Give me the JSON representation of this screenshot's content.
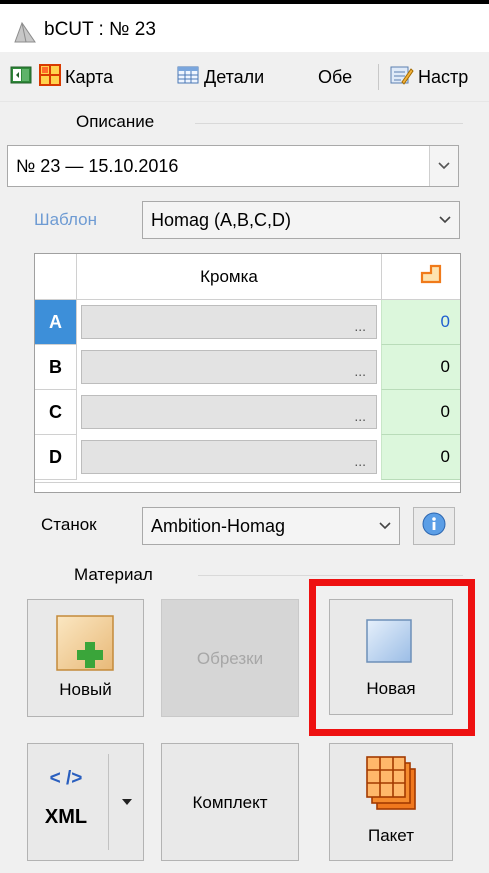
{
  "window": {
    "title": "bCUT : № 23"
  },
  "toolbar": {
    "items": [
      {
        "label": ""
      },
      {
        "label": "Карта"
      },
      {
        "label": "Детали"
      },
      {
        "label": "Обе"
      },
      {
        "label": "Настр"
      }
    ]
  },
  "description": {
    "group_label": "Описание",
    "value": "№ 23 — 15.10.2016"
  },
  "template": {
    "label": "Шаблон",
    "value": "Homag (A,B,C,D)"
  },
  "edge_grid": {
    "header": "Кромка",
    "rows": [
      {
        "name": "A",
        "dots": "...",
        "value": "0"
      },
      {
        "name": "B",
        "dots": "...",
        "value": "0"
      },
      {
        "name": "C",
        "dots": "...",
        "value": "0"
      },
      {
        "name": "D",
        "dots": "...",
        "value": "0"
      }
    ]
  },
  "machine": {
    "label": "Станок",
    "value": "Ambition-Homag"
  },
  "material": {
    "group_label": "Материал",
    "buttons": {
      "new": "Новый",
      "offcuts": "Обрезки",
      "new_sheet": "Новая",
      "xml_top": "< />",
      "xml_bottom": "XML",
      "kit": "Комплект",
      "package": "Пакет"
    }
  },
  "colors": {
    "accent_blue": "#3d8fd9",
    "value_cell_green": "#dcf7dc",
    "highlight_red": "#ee1111",
    "icon_orange": "#f07a1a",
    "plus_green": "#3aa53a"
  }
}
